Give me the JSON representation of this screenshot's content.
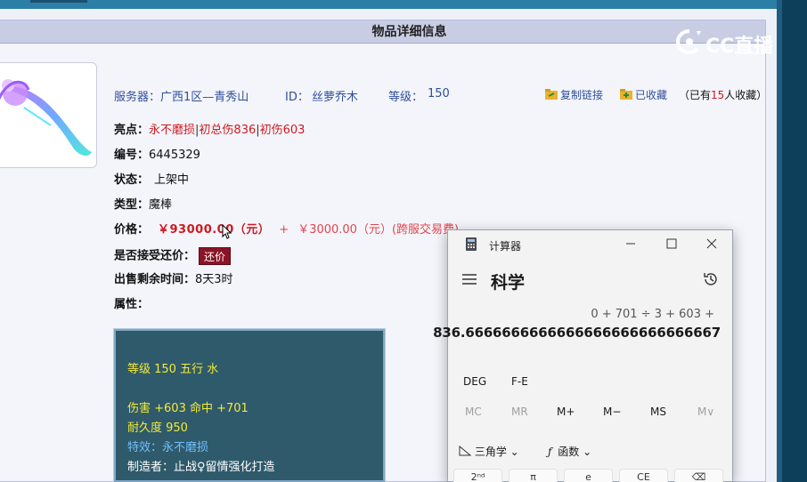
{
  "panel": {
    "title": "物品详细信息"
  },
  "item_top": {
    "server_label": "服务器：",
    "server_value": "广西1区—青秀山",
    "id_label": "ID：",
    "id_value": "丝萝乔木",
    "level_label": "等级：",
    "level_value": "150"
  },
  "actions": {
    "copy_link": "复制链接",
    "favorited": "已收藏",
    "fav_prefix": "（已有",
    "fav_count": "15",
    "fav_suffix": "人收藏）"
  },
  "details": {
    "highlight_label": "亮点：",
    "highlight_1": "永不磨损",
    "highlight_sep": "|",
    "highlight_2": "初总伤836",
    "highlight_3": "初伤603",
    "number_label": "编号：",
    "number_value": "6445329",
    "status_label": "状态：",
    "status_value": "上架中",
    "type_label": "类型：",
    "type_value": "魔棒",
    "price_label": "价格：",
    "price_main": "￥93000.00（元）",
    "price_plus": "+",
    "price_extra": "￥3000.00（元）(跨服交易费)",
    "counter_label": "是否接受还价：",
    "counter_button": "还价",
    "remaining_label": "出售剩余时间：",
    "remaining_value": "8天3时",
    "attr_label": "属性："
  },
  "attributes": {
    "line_level": "等级 150  五行  水",
    "line_damage": "伤害 +603  命中 +701",
    "line_durability": "耐久度 950",
    "line_special": "特效：永不磨损",
    "line_maker": "制造者：止战♀留情强化打造"
  },
  "watermark": {
    "text": "CC直播"
  },
  "calculator": {
    "window_title": "计算器",
    "mode": "科学",
    "expression": "0 + 701 ÷ 3 + 603 +",
    "result": "836.6666666666666666666666666667",
    "deg": "DEG",
    "fe": "F-E",
    "mem": [
      "MC",
      "MR",
      "M+",
      "M−",
      "MS",
      "M∨"
    ],
    "trig": "三角学",
    "func": "函数",
    "key_labels": [
      "2ⁿᵈ",
      "π",
      "e",
      "CE",
      "⌫"
    ],
    "colors": {
      "accent": "#1a1a1a",
      "disabled": "#a0a0a0"
    }
  }
}
